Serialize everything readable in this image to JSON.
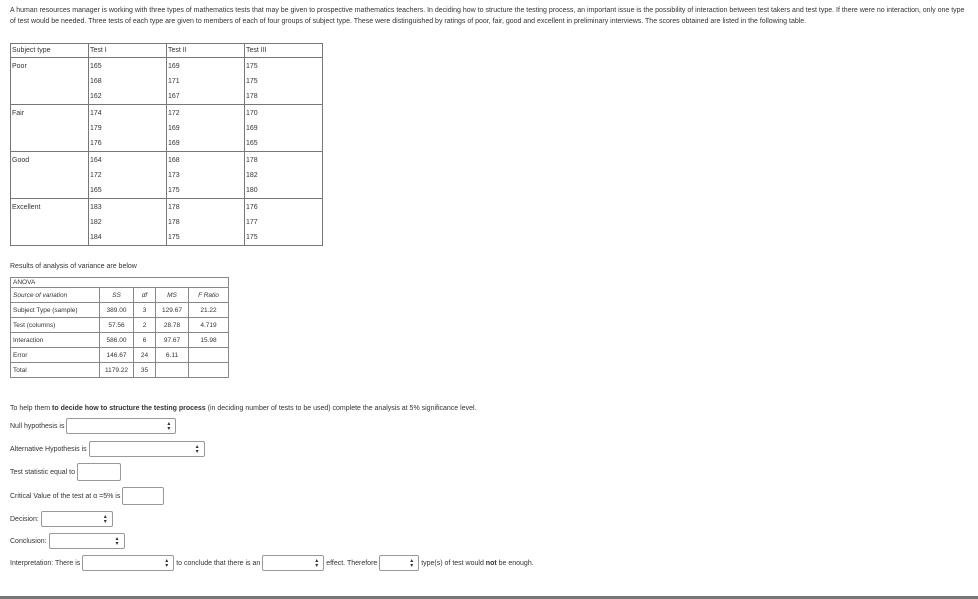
{
  "intro": "A human resources manager is working with three types of mathematics tests that may be given to prospective mathematics teachers. In deciding how to structure the testing process, an important issue is the possibility of interaction between test takers and test type. If there were no interaction, only one type of test would be needed. Three tests of each type are given to members of each of four groups of subject type. These were distinguished by ratings of poor, fair, good and excellent in preliminary interviews. The scores obtained are listed in the following table.",
  "data_table": {
    "headers": [
      "Subject type",
      "Test I",
      "Test II",
      "Test III"
    ],
    "groups": [
      {
        "label": "Poor",
        "test1": [
          "165",
          "168",
          "162"
        ],
        "test2": [
          "169",
          "171",
          "167"
        ],
        "test3": [
          "175",
          "175",
          "178"
        ]
      },
      {
        "label": "Fair",
        "test1": [
          "174",
          "179",
          "176"
        ],
        "test2": [
          "172",
          "169",
          "169"
        ],
        "test3": [
          "170",
          "169",
          "165"
        ]
      },
      {
        "label": "Good",
        "test1": [
          "164",
          "172",
          "165"
        ],
        "test2": [
          "168",
          "173",
          "175"
        ],
        "test3": [
          "178",
          "182",
          "180"
        ]
      },
      {
        "label": "Excellent",
        "test1": [
          "183",
          "182",
          "184"
        ],
        "test2": [
          "178",
          "178",
          "175"
        ],
        "test3": [
          "176",
          "177",
          "175"
        ]
      }
    ]
  },
  "anova_caption": "Results of analysis of variance are below",
  "anova": {
    "title": "ANOVA",
    "headers": [
      "Source of variation",
      "SS",
      "df",
      "MS",
      "F Ratio"
    ],
    "rows": [
      {
        "source": "Subject Type (sample)",
        "ss": "389.00",
        "df": "3",
        "ms": "129.67",
        "f": "21.22"
      },
      {
        "source": "Test (columns)",
        "ss": "57.56",
        "df": "2",
        "ms": "28.78",
        "f": "4.719"
      },
      {
        "source": "Interaction",
        "ss": "586.00",
        "df": "6",
        "ms": "97.67",
        "f": "15.98"
      },
      {
        "source": "Error",
        "ss": "146.67",
        "df": "24",
        "ms": "6.11",
        "f": ""
      },
      {
        "source": "Total",
        "ss": "1179.22",
        "df": "35",
        "ms": "",
        "f": ""
      }
    ]
  },
  "question": {
    "prefix": "To help them ",
    "bold": "to decide how to structure the testing process",
    "suffix": " (in deciding number of tests to be used) complete the analysis at 5% significance level."
  },
  "form": {
    "null_label": "Null hypothesis is",
    "alt_label": "Alternative Hypothesis is",
    "stat_label": "Test statistic equal to",
    "crit_label": "Critical Value of the test at α =5% is",
    "decision_label": "Decision:",
    "conclusion_label": "Conclusion:",
    "interp_part1": "Interpretation: There is",
    "interp_part2": "to conclude that there is an",
    "interp_part3": "effect. Therefore",
    "interp_part4": "type(s) of test would ",
    "interp_bold": "not",
    "interp_part5": " be enough."
  },
  "icons": {
    "select_arrow": "up-down-chevron-icon"
  }
}
